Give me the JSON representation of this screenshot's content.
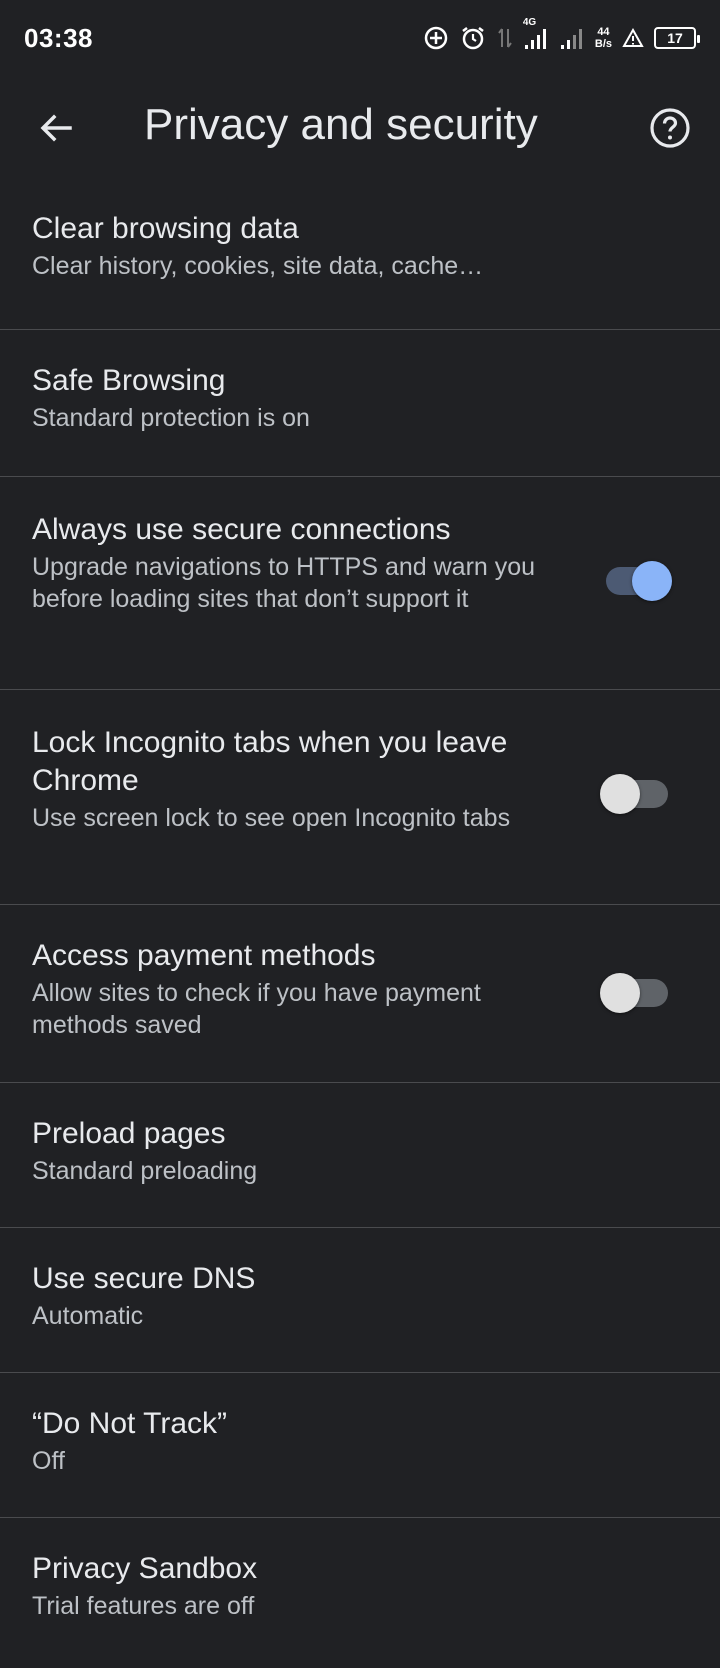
{
  "status_bar": {
    "time": "03:38",
    "network_label": "4G",
    "speed_value": "44",
    "speed_unit": "B/s",
    "battery_level": "17",
    "icons": [
      "data-saver-icon",
      "alarm-icon",
      "data-arrows-icon",
      "signal-icon",
      "signal-weak-icon",
      "warning-icon",
      "battery-icon"
    ]
  },
  "appbar": {
    "title": "Privacy and security",
    "back_icon": "arrow-left-icon",
    "help_icon": "help-circle-icon"
  },
  "accent_color": "#8ab4f8",
  "settings": [
    {
      "title": "Clear browsing data",
      "subtitle": "Clear history, cookies, site data, cache…"
    },
    {
      "title": "Safe Browsing",
      "subtitle": "Standard protection is on"
    },
    {
      "title": "Always use secure connections",
      "subtitle": "Upgrade navigations to HTTPS and warn you before loading sites that don’t support it",
      "toggle": true
    },
    {
      "title": "Lock Incognito tabs when you leave Chrome",
      "subtitle": "Use screen lock to see open Incognito tabs",
      "toggle": false
    },
    {
      "title": "Access payment methods",
      "subtitle": "Allow sites to check if you have payment methods saved",
      "toggle": false
    },
    {
      "title": "Preload pages",
      "subtitle": "Standard preloading"
    },
    {
      "title": "Use secure DNS",
      "subtitle": "Automatic"
    },
    {
      "title": "“Do Not Track”",
      "subtitle": "Off"
    },
    {
      "title": "Privacy Sandbox",
      "subtitle": "Trial features are off"
    }
  ]
}
